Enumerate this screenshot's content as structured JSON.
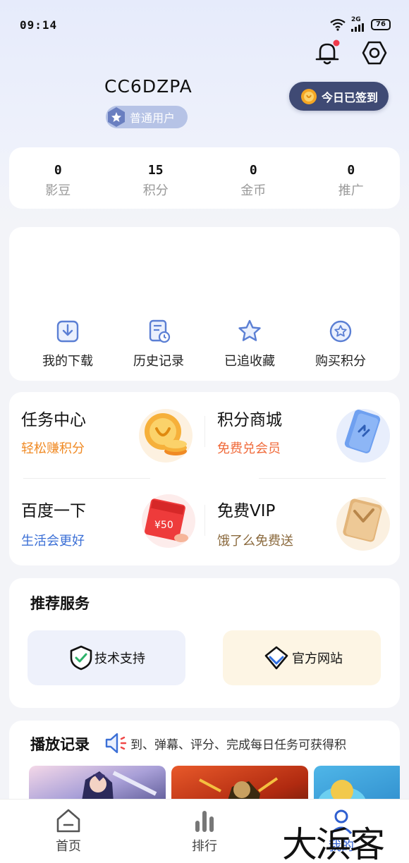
{
  "status_bar": {
    "time": "09:14",
    "network": "2G",
    "battery": "76"
  },
  "header": {
    "username": "CC6DZPA",
    "user_level": "普通用户",
    "checkin_label": "今日已签到"
  },
  "stats": [
    {
      "value": "0",
      "label": "影豆"
    },
    {
      "value": "15",
      "label": "积分"
    },
    {
      "value": "0",
      "label": "金币"
    },
    {
      "value": "0",
      "label": "推广"
    }
  ],
  "actions": [
    {
      "label": "我的下载",
      "icon": "download-icon"
    },
    {
      "label": "历史记录",
      "icon": "history-icon"
    },
    {
      "label": "已追收藏",
      "icon": "star-icon"
    },
    {
      "label": "购买积分",
      "icon": "star-circle-icon"
    }
  ],
  "promos": [
    {
      "title": "任务中心",
      "subtitle": "轻松赚积分",
      "color": "#f08a24"
    },
    {
      "title": "积分商城",
      "subtitle": "免费兑会员",
      "color": "#f06a3a"
    },
    {
      "title": "百度一下",
      "subtitle": "生活会更好",
      "color": "#3b6fd6"
    },
    {
      "title": "免费VIP",
      "subtitle": "饿了么免费送",
      "color": "#8b6a3e"
    }
  ],
  "promo_art": {
    "coupon_text": "¥50"
  },
  "services": {
    "title": "推荐服务",
    "items": [
      {
        "label": "技术支持",
        "bg": "#eef1fb"
      },
      {
        "label": "官方网站",
        "bg": "#fdf5e4"
      }
    ]
  },
  "history": {
    "title": "播放记录",
    "marquee": "到、弹幕、评分、完成每日任务可获得积"
  },
  "bottom_nav": [
    {
      "label": "首页"
    },
    {
      "label": "排行"
    },
    {
      "label": "我的"
    }
  ],
  "watermark": "大浜客"
}
